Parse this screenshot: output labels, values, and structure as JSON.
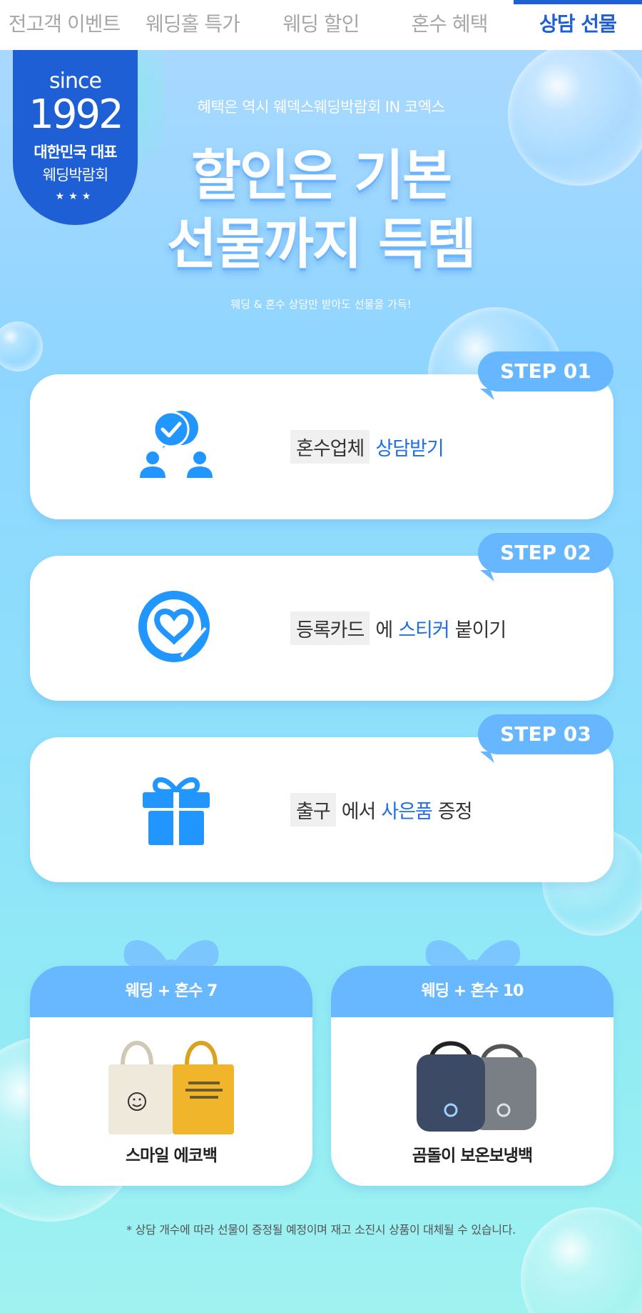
{
  "tabs": [
    {
      "label": "전고객 이벤트"
    },
    {
      "label": "웨딩홀 특가"
    },
    {
      "label": "웨딩 할인"
    },
    {
      "label": "혼수 혜택"
    },
    {
      "label": "상담 선물",
      "active": true
    }
  ],
  "badge": {
    "since": "since",
    "year": "1992",
    "line1": "대한민국 대표",
    "line2": "웨딩박람회",
    "stars": "★★★"
  },
  "hero": {
    "subtitle": "혜택은 역시 웨덱스웨딩박람회 IN 코엑스",
    "headline_1": "할인은 기본",
    "headline_2": "선물까지 득템",
    "small": "웨딩 & 혼수 상담만 받아도 선물을 가득!"
  },
  "steps": [
    {
      "label": "STEP 01",
      "icon": "consult-icon",
      "gray": "혼수업체",
      "mid": "",
      "blue": "상담받기",
      "tail": ""
    },
    {
      "label": "STEP 02",
      "icon": "sticker-heart-icon",
      "gray": "등록카드",
      "mid": "에",
      "blue": "스티커",
      "tail": "붙이기"
    },
    {
      "label": "STEP 03",
      "icon": "gift-icon",
      "gray": "출구",
      "mid": "에서",
      "blue": "사은품",
      "tail": "증정"
    }
  ],
  "gifts": [
    {
      "head": "웨딩 + 혼수 7",
      "name": "스마일 에코백",
      "image": "eco-bag-image"
    },
    {
      "head": "웨딩 + 혼수 10",
      "name": "곰돌이 보온보냉백",
      "image": "cooler-bag-image"
    }
  ],
  "note": "* 상담 개수에 따라 선물이 증정될 예정이며 재고 소진시 상품이 대체될 수 있습니다.",
  "colors": {
    "brand_blue": "#1f5fd6",
    "step_blue": "#66b7ff",
    "icon_blue": "#2196ff",
    "highlight_blue": "#1f6ee6"
  }
}
